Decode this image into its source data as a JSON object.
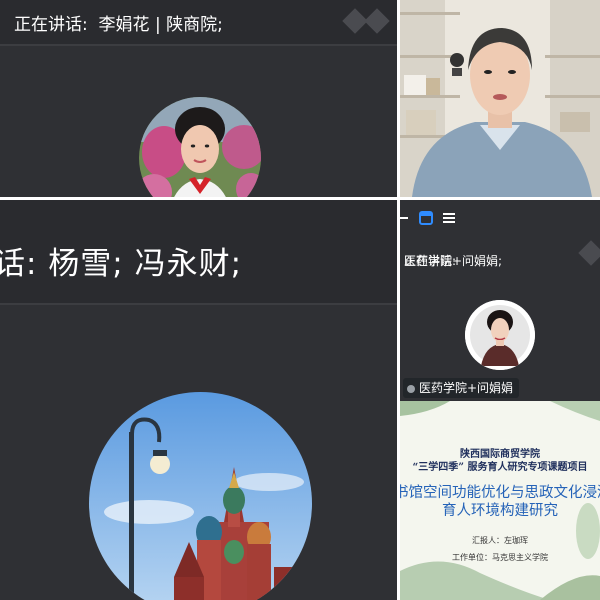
{
  "top_left": {
    "speaking_label": "正在讲话:",
    "speaking_names": "李娟花 | 陕商院;"
  },
  "bottom_left": {
    "speaking_text": "话:  杨雪; 冯永财;"
  },
  "bottom_right": {
    "speaking_label": "正在讲话:",
    "speaking_names": "医药学院+问娟娟;",
    "name_tag": "医药学院+问娟娟"
  },
  "slide": {
    "line1": "陕西国际商贸学院",
    "line2": "“三学四季” 服务育人研究专项课题项目",
    "title_line1": "书馆空间功能优化与思政文化浸润",
    "title_line2": "育人环境构建研究",
    "reporter": "汇报人：左珈珲",
    "unit": "工作单位：马克思主义学院"
  },
  "colors": {
    "panel_bg": "#2f3034",
    "slide_title": "#2563b8",
    "slide_heading": "#1f2f5c",
    "active_icon": "#2f8cff"
  }
}
